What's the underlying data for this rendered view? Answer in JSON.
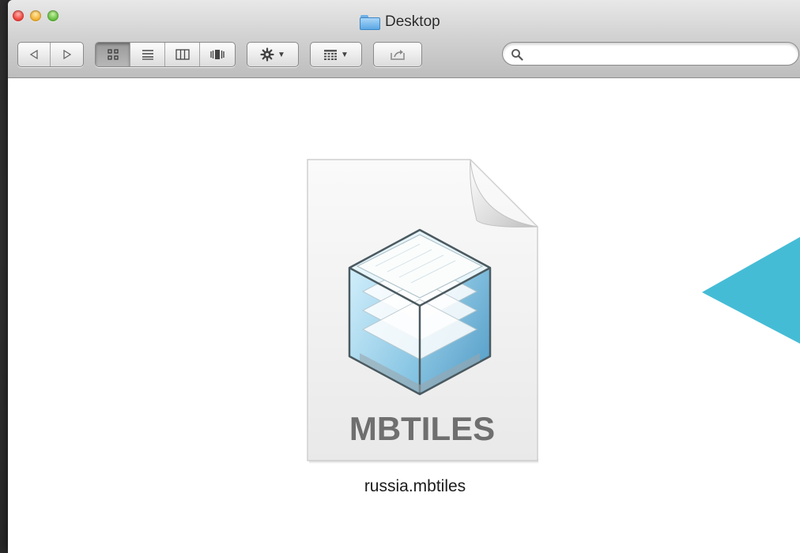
{
  "window": {
    "title": "Desktop"
  },
  "toolbar": {
    "back_icon": "triangle-left-icon",
    "forward_icon": "triangle-right-icon",
    "views": [
      "icon-view-icon",
      "list-view-icon",
      "column-view-icon",
      "coverflow-view-icon"
    ],
    "active_view_index": 0,
    "action_icon": "gear-icon",
    "arrange_icon": "grid-icon",
    "share_icon": "share-icon"
  },
  "search": {
    "value": "",
    "placeholder": ""
  },
  "file": {
    "name": "russia.mbtiles",
    "icon_label": "MBTILES"
  },
  "colors": {
    "accent_arrow": "#45bcd6",
    "folder_blue": "#5ba7e4"
  }
}
